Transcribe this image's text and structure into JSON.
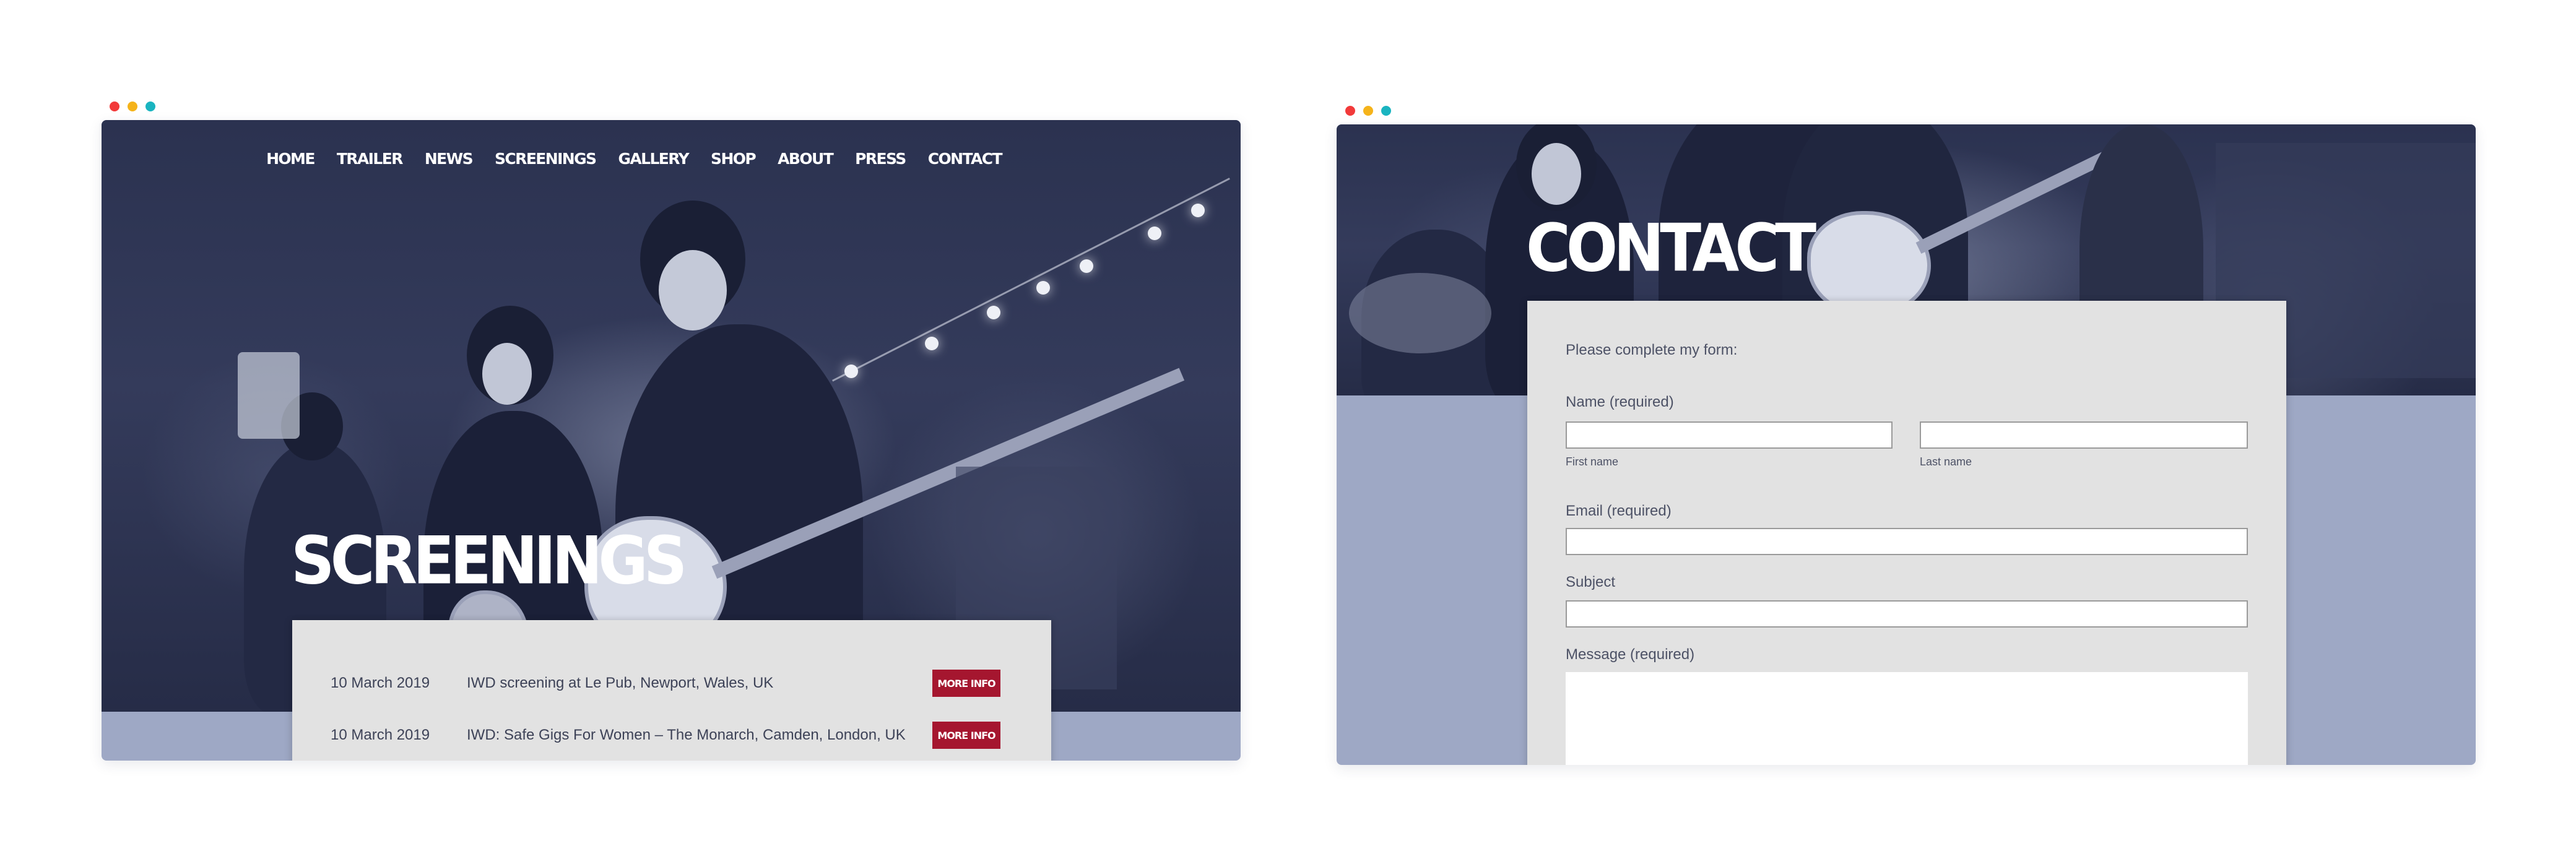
{
  "window_controls": {
    "colors": {
      "close": "#f23a3a",
      "minimize": "#f5b31a",
      "maximize": "#1ab4c0"
    }
  },
  "screenings_page": {
    "nav": [
      "HOME",
      "TRAILER",
      "NEWS",
      "SCREENINGS",
      "GALLERY",
      "SHOP",
      "ABOUT",
      "PRESS",
      "CONTACT"
    ],
    "title": "SCREENINGS",
    "events": [
      {
        "date": "10 March 2019",
        "title": "IWD screening at Le Pub, Newport, Wales, UK",
        "button": "MORE INFO"
      },
      {
        "date": "10 March 2019",
        "title": "IWD: Safe Gigs For Women – The Monarch, Camden, London, UK",
        "button": "MORE INFO"
      }
    ]
  },
  "contact_page": {
    "title": "CONTACT",
    "form": {
      "intro": "Please complete my form:",
      "name_label": "Name (required)",
      "first_name_sub": "First name",
      "last_name_sub": "Last name",
      "first_name_value": "",
      "last_name_value": "",
      "email_label": "Email (required)",
      "email_value": "",
      "subject_label": "Subject",
      "subject_value": "",
      "message_label": "Message (required)",
      "message_value": ""
    }
  },
  "colors": {
    "hero_overlay": "#2b3250",
    "band_bg": "#9ea8c5",
    "panel_bg": "#e2e2e2",
    "button_red": "#a5162f",
    "text": "#3d4257"
  }
}
